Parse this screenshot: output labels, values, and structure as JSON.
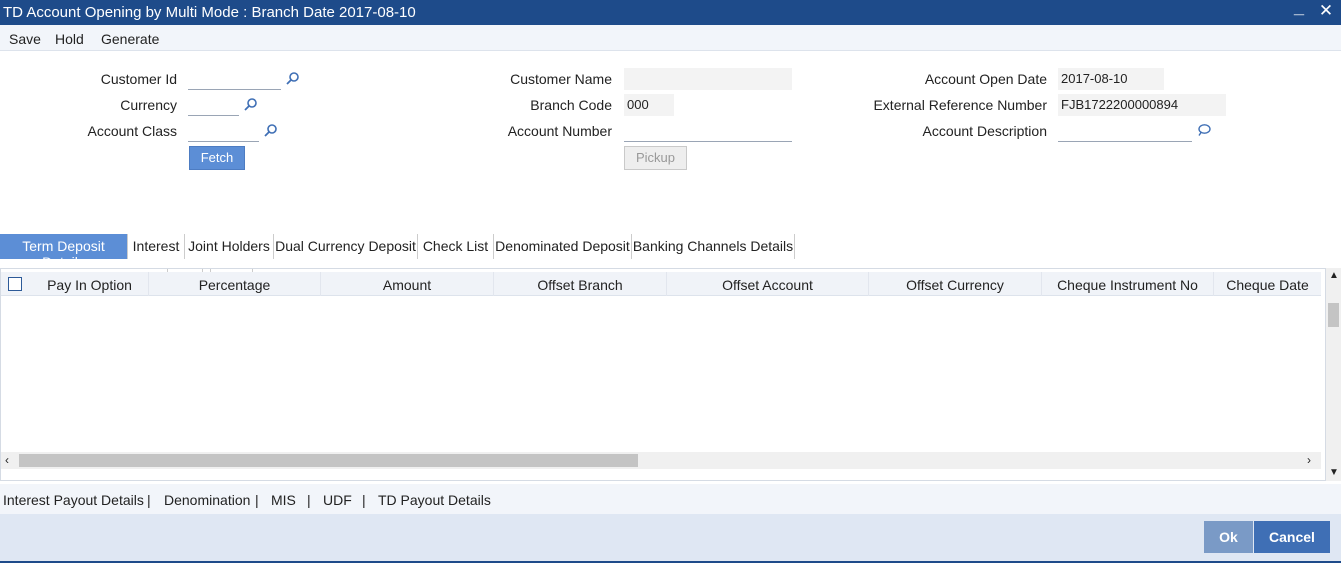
{
  "window": {
    "title": "TD Account Opening by Multi Mode : Branch Date 2017-08-10"
  },
  "toolbar": {
    "save": "Save",
    "hold": "Hold",
    "generate": "Generate"
  },
  "form": {
    "customer_id_label": "Customer Id",
    "customer_id_value": "",
    "currency_label": "Currency",
    "currency_value": "",
    "account_class_label": "Account Class",
    "account_class_value": "",
    "fetch_label": "Fetch",
    "customer_name_label": "Customer Name",
    "customer_name_value": "",
    "branch_code_label": "Branch Code",
    "branch_code_value": "000",
    "account_number_label": "Account Number",
    "account_number_value": "",
    "pickup_label": "Pickup",
    "account_open_date_label": "Account Open Date",
    "account_open_date_value": "2017-08-10",
    "external_ref_label": "External Reference Number",
    "external_ref_value": "FJB1722200000894",
    "account_description_label": "Account Description",
    "account_description_value": ""
  },
  "tabs": [
    "Term Deposit Details",
    "Interest",
    "Joint Holders",
    "Dual Currency Deposit",
    "Check List",
    "Denominated Deposit",
    "Banking Channels Details"
  ],
  "grid": {
    "columns": [
      "Pay In Option",
      "Percentage",
      "Amount",
      "Offset Branch",
      "Offset Account",
      "Offset Currency",
      "Cheque Instrument No",
      "Cheque Date"
    ],
    "rows": []
  },
  "footer_links": [
    "Interest Payout Details",
    "|",
    "Denomination",
    "|",
    "MIS",
    "|",
    "UDF",
    "|",
    "TD Payout Details"
  ],
  "actions": {
    "ok": "Ok",
    "cancel": "Cancel"
  },
  "colors": {
    "title_bar": "#1e4b8a",
    "accent": "#5c8ed6",
    "ok_button": "#7a9ac6",
    "cancel_button": "#3f6fb5"
  }
}
